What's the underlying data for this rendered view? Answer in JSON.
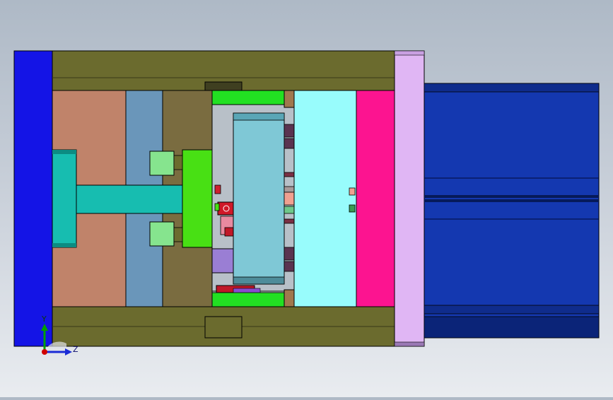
{
  "view": {
    "background_top": "#aeb9c6",
    "background_bottom": "#e9ecf0"
  },
  "triad": {
    "y_label": "Y",
    "z_label": "Z",
    "y_color": "#00a000",
    "z_color": "#1a2bd6",
    "origin_color": "#d00000"
  },
  "colors": {
    "fixed_platen": "#1414e6",
    "tie_bar": "#6b6b2e",
    "clamp_plate": "#c0836a",
    "spacer_blue": "#6a96ba",
    "spacer_olive": "#7a6c40",
    "sprue": "#17bdb0",
    "ejector": "#48e014",
    "guide_pin": "#22e022",
    "cavity": "#7fc8d6",
    "cyan_plate": "#98fcfc",
    "magenta_plate": "#fc1490",
    "lilac_platen": "#e0b6f4",
    "cylinder": "#1438b0"
  }
}
